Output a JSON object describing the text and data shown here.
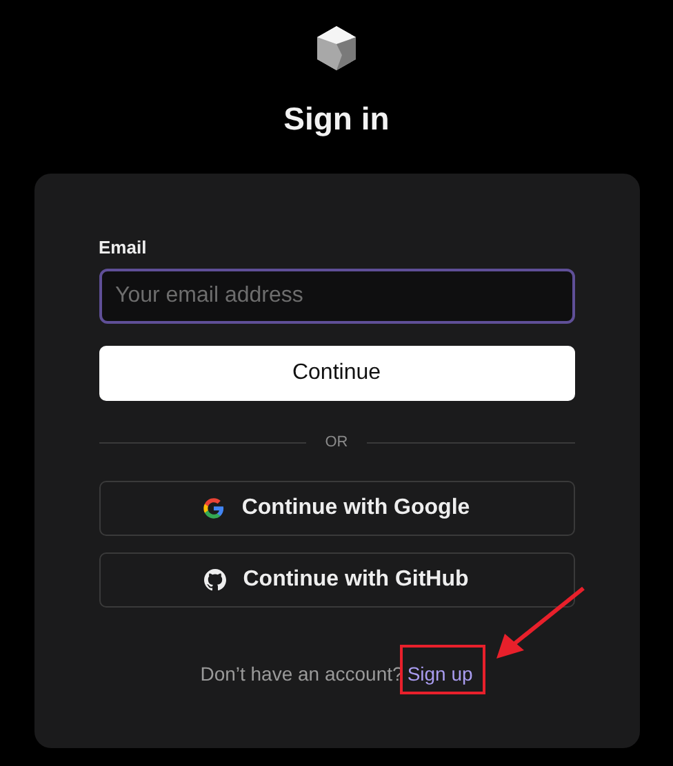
{
  "title": "Sign in",
  "email": {
    "label": "Email",
    "placeholder": "Your email address",
    "focused": true
  },
  "continue_button": "Continue",
  "divider": "OR",
  "providers": [
    {
      "kind": "google",
      "label": "Continue with Google"
    },
    {
      "kind": "github",
      "label": "Continue with GitHub"
    }
  ],
  "footer": {
    "text": "Don’t have an account?",
    "link": "Sign up"
  }
}
